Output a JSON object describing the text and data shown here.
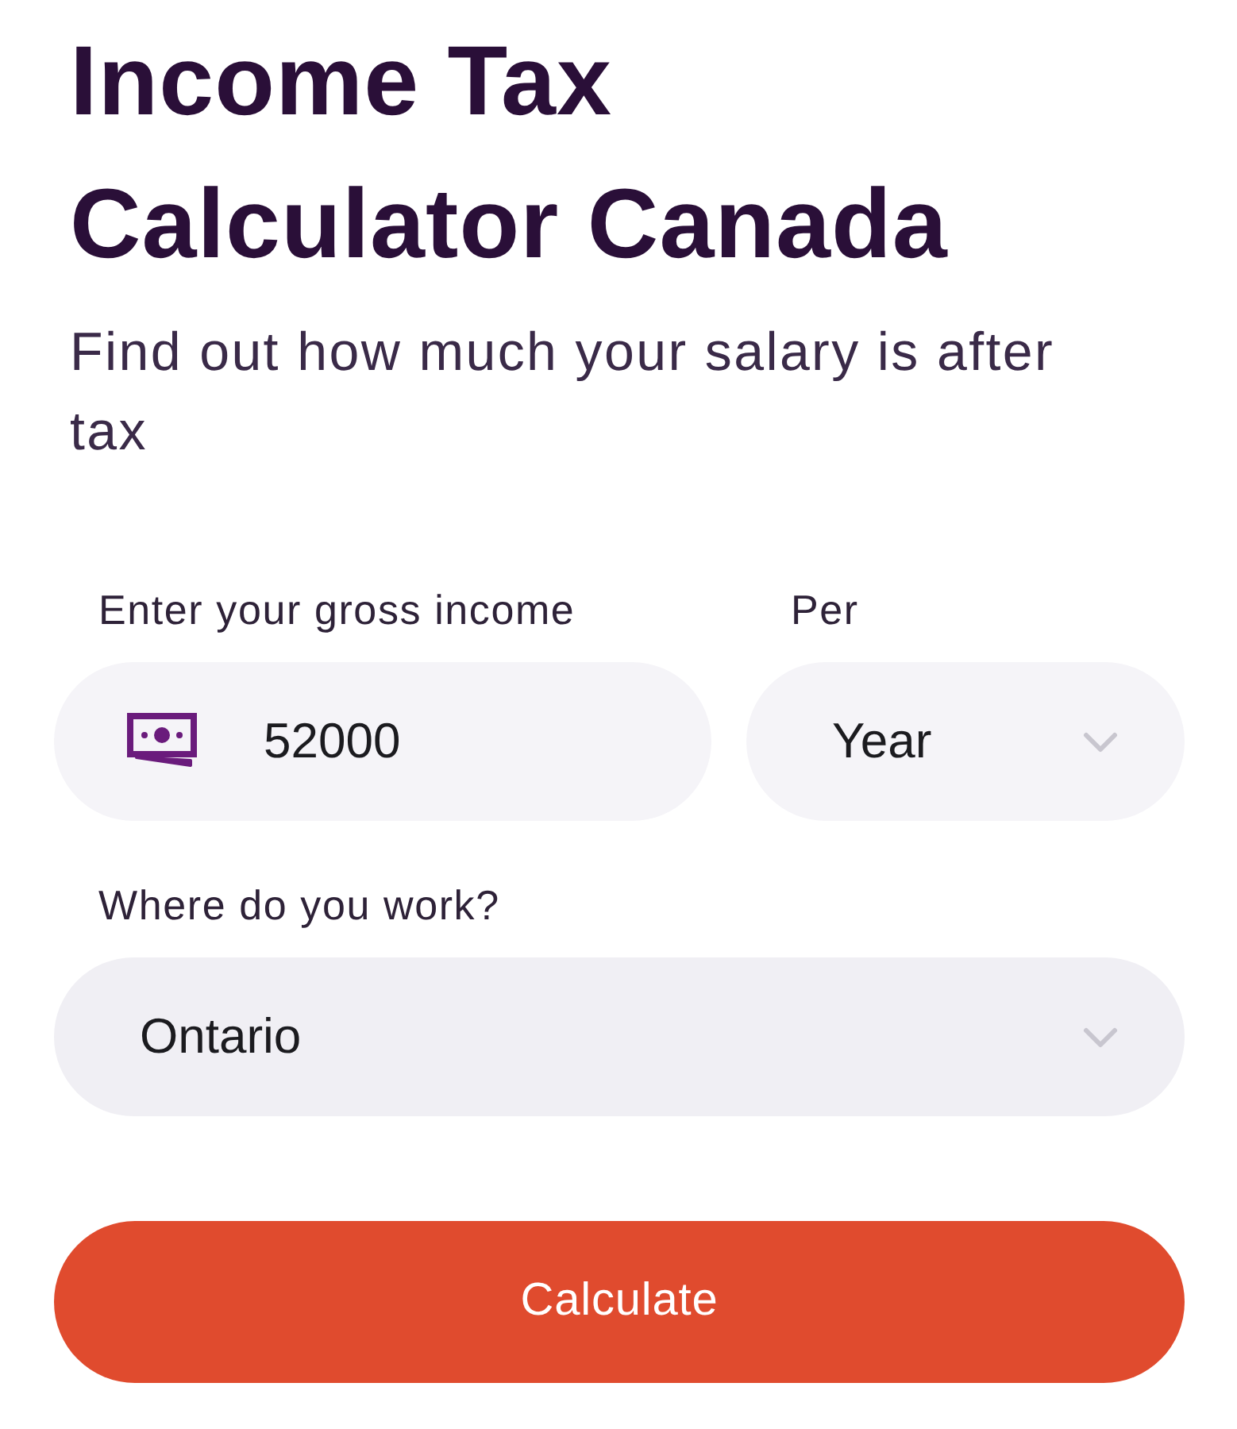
{
  "title": "Income Tax Calculator Canada",
  "subtitle": "Find out how much your salary is after tax",
  "form": {
    "income": {
      "label": "Enter your gross income",
      "value": "52000"
    },
    "period": {
      "label": "Per",
      "value": "Year"
    },
    "province": {
      "label": "Where do you work?",
      "value": "Ontario"
    }
  },
  "submit_button": {
    "label": "Calculate"
  }
}
